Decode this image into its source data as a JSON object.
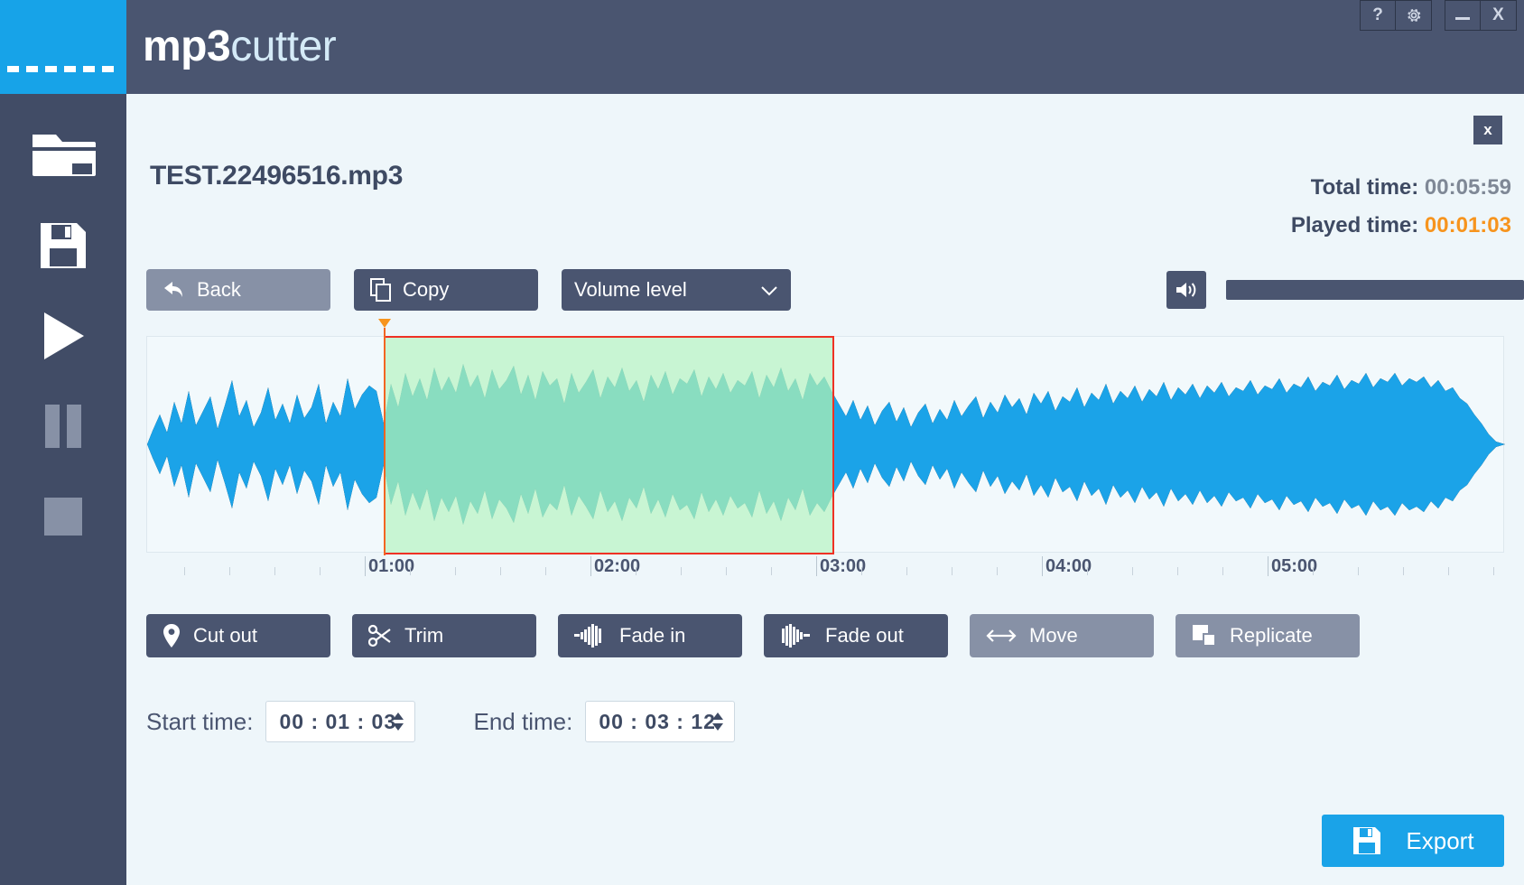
{
  "app": {
    "title_part1": "mp3",
    "title_part2": "cutter",
    "accent_blue": "#17a3e8",
    "dark_navy": "#4a5570",
    "panel_bg": "#eef6fa",
    "orange": "#f7941d",
    "selection_red": "#ef3124",
    "selection_green": "#b7f3c4"
  },
  "window_controls": {
    "help": "?",
    "settings_icon": "gear-icon",
    "minimize": "—",
    "close": "X"
  },
  "sidebar": {
    "items": [
      {
        "name": "open-folder",
        "icon": "folder-icon"
      },
      {
        "name": "save",
        "icon": "floppy-disk-icon"
      },
      {
        "name": "play",
        "icon": "play-icon"
      },
      {
        "name": "pause",
        "icon": "pause-icon"
      },
      {
        "name": "stop",
        "icon": "stop-icon"
      }
    ]
  },
  "dialog": {
    "close_label": "x",
    "filename": "TEST.22496516.mp3",
    "total_time_label": "Total time:",
    "total_time_value": "00:05:59",
    "played_time_label": "Played time:",
    "played_time_value": "00:01:03"
  },
  "toolbar": {
    "back_label": "Back",
    "copy_label": "Copy",
    "volume_select_value": "Volume level",
    "volume_icon": "speaker-icon"
  },
  "actions": [
    {
      "label": "Cut out",
      "icon": "pin-icon",
      "state": "enabled"
    },
    {
      "label": "Trim",
      "icon": "scissors-icon",
      "state": "enabled"
    },
    {
      "label": "Fade in",
      "icon": "fade-in-icon",
      "state": "enabled"
    },
    {
      "label": "Fade out",
      "icon": "fade-out-icon",
      "state": "enabled"
    },
    {
      "label": "Move",
      "icon": "arrows-horizontal-icon",
      "state": "disabled"
    },
    {
      "label": "Replicate",
      "icon": "copy-squares-icon",
      "state": "disabled"
    }
  ],
  "time_fields": {
    "start_label": "Start time:",
    "start_value": "00 : 01 : 03",
    "end_label": "End time:",
    "end_value": "00 : 03 : 12"
  },
  "export": {
    "label": "Export",
    "icon": "floppy-disk-icon"
  },
  "timeline": {
    "labels": [
      "01:00",
      "02:00",
      "03:00",
      "04:00",
      "05:00"
    ],
    "total_seconds": 359,
    "selection_start": "00:01:03",
    "selection_end": "00:03:12",
    "playhead": "00:01:03"
  }
}
